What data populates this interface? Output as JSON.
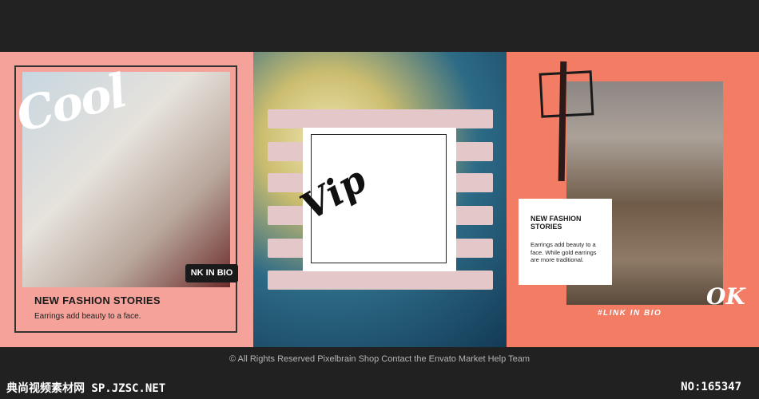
{
  "panels": {
    "one": {
      "overlay_word": "Cool",
      "link_badge": "NK IN BIO",
      "title": "NEW FASHION STORIES",
      "description": "Earrings add beauty to a face."
    },
    "two": {
      "overlay_word": "Vip"
    },
    "three": {
      "card_title": "NEW FASHION STORIES",
      "card_description": "Earrings add beauty to a face. While gold earrings are more traditional.",
      "overlay_word": "OK",
      "link": "#LINK IN BIO"
    }
  },
  "footer": {
    "copyright": "© All Rights Reserved Pixelbrain Shop Contact the Envato Market Help Team"
  },
  "watermark": {
    "left": "典尚视频素材网 SP.JZSC.NET",
    "right": "NO:165347"
  }
}
